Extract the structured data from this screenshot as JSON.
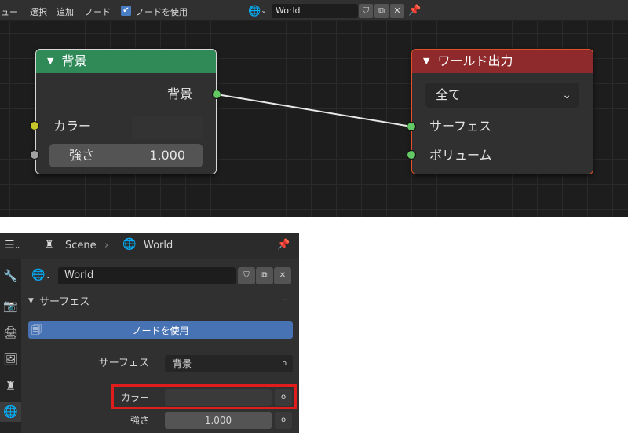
{
  "node_editor": {
    "header": {
      "menu": [
        "ビュー",
        "選択",
        "追加",
        "ノード"
      ],
      "use_nodes_label": "ノードを使用",
      "use_nodes_checked": "✔",
      "world_name": "World",
      "world_icon": "world-icon"
    },
    "background_node": {
      "title": "背景",
      "header_color": "#2f8a58",
      "output_label": "背景",
      "color_label": "カラー",
      "strength_label": "強さ",
      "strength_value": "1.000"
    },
    "world_output_node": {
      "title": "ワールド出力",
      "header_color": "#8e2a2c",
      "target_value": "全て",
      "surface_label": "サーフェス",
      "volume_label": "ボリューム"
    },
    "colors": {
      "shader_socket": "#63c763",
      "color_socket": "#c7c729",
      "value_socket": "#a1a1a1"
    }
  },
  "properties": {
    "breadcrumb": {
      "scene": "Scene",
      "world": "World",
      "separator": "›"
    },
    "world_name": "World",
    "section_title": "サーフェス",
    "use_nodes_button": "ノードを使用",
    "surface_label": "サーフェス",
    "surface_value": "背景",
    "color_label": "カラー",
    "strength_label": "強さ",
    "strength_value": "1.000",
    "highlight_color": "#e11c1c"
  }
}
